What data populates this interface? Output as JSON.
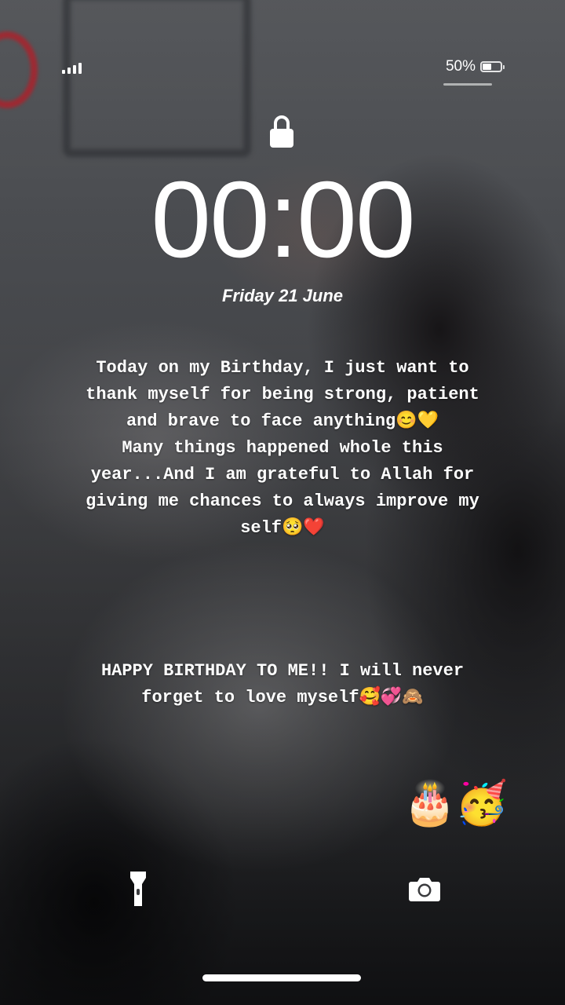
{
  "status_bar": {
    "battery_percent": "50%",
    "battery_level": 0.5,
    "signal_bars": 4
  },
  "lock_screen": {
    "time": "00:00",
    "date": "Friday 21 June"
  },
  "story": {
    "paragraph_1": [
      "Today on my Birthday, I just want to",
      "thank myself for being strong, patient",
      "and brave to face anything😊💛",
      "Many things happened whole this",
      "year...And I am grateful to Allah for",
      "giving me chances to always improve my",
      "self🥺❤️"
    ],
    "paragraph_2": [
      "HAPPY BIRTHDAY TO ME!! I will never",
      "forget to love myself🥰💞🙈"
    ],
    "stickers": {
      "cake": "🎂",
      "party_face": "🥳"
    }
  },
  "icons": {
    "lock": "lock-icon",
    "flashlight": "flashlight-icon",
    "camera": "camera-icon"
  }
}
